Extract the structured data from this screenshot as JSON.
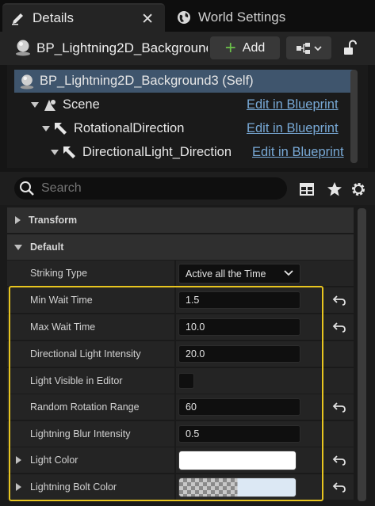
{
  "tabs": [
    {
      "label": "Details",
      "active": true,
      "close": "✕"
    },
    {
      "label": "World Settings",
      "active": false
    }
  ],
  "header": {
    "actor_name": "BP_Lightning2D_Background3",
    "add_label": "Add"
  },
  "tree": {
    "rows": [
      {
        "label": "BP_Lightning2D_Background3 (Self)",
        "edit": ""
      },
      {
        "label": "Scene",
        "edit": "Edit in Blueprint"
      },
      {
        "label": "RotationalDirection",
        "edit": "Edit in Blueprint"
      },
      {
        "label": "DirectionalLight_Direction",
        "edit": "Edit in Blueprint"
      }
    ]
  },
  "search": {
    "placeholder": "Search"
  },
  "categories": {
    "transform": "Transform",
    "default": "Default"
  },
  "properties": {
    "striking_type": {
      "label": "Striking Type",
      "value": "Active all the Time"
    },
    "min_wait": {
      "label": "Min Wait Time",
      "value": "1.5"
    },
    "max_wait": {
      "label": "Max Wait Time",
      "value": "10.0"
    },
    "dir_light_intensity": {
      "label": "Directional Light Intensity",
      "value": "20.0"
    },
    "light_visible": {
      "label": "Light Visible in Editor",
      "checked": false
    },
    "random_rotation": {
      "label": "Random Rotation Range",
      "value": "60"
    },
    "blur_intensity": {
      "label": "Lightning Blur Intensity",
      "value": "0.5"
    },
    "light_color": {
      "label": "Light Color",
      "color": "#ffffff"
    },
    "bolt_color": {
      "label": "Lightning Bolt Color",
      "color": "#dce8f4",
      "alpha_split": 0.5
    }
  },
  "colors": {
    "highlight": "#e8c51f",
    "selection": "#3f556d",
    "link": "#78a9d6",
    "add_plus": "#6cc24a"
  }
}
